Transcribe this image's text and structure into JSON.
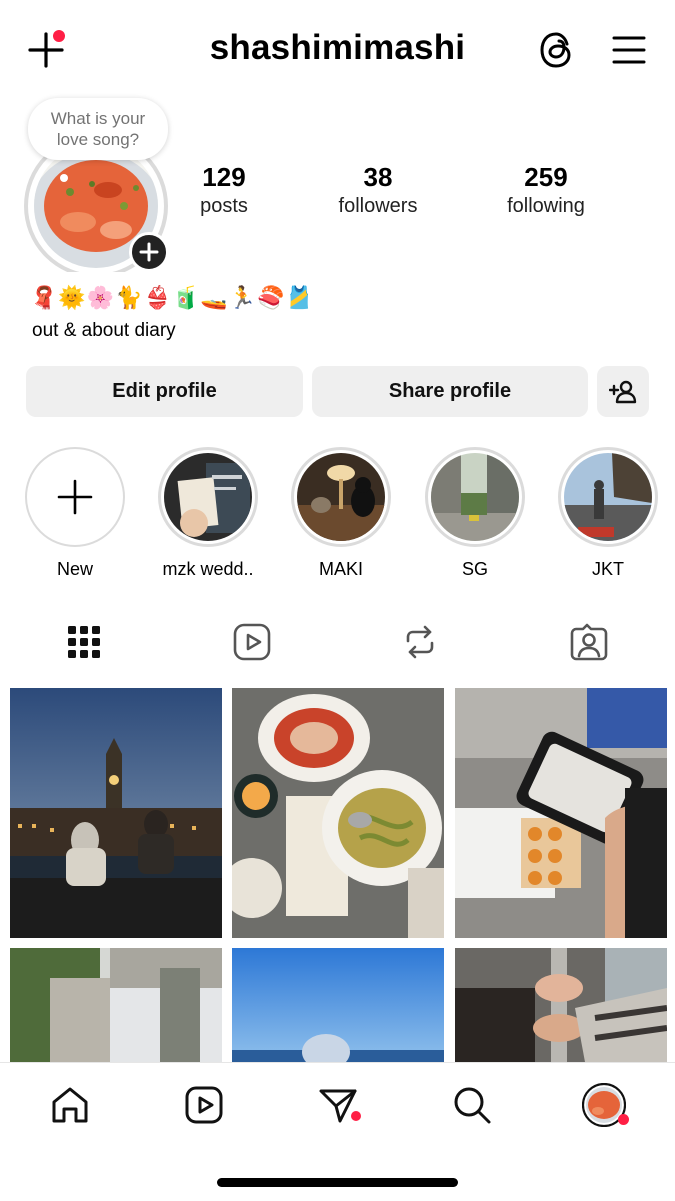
{
  "header": {
    "username": "shashimimashi"
  },
  "note": {
    "text": "What is your love song?"
  },
  "stats": [
    {
      "value": "129",
      "label": "posts"
    },
    {
      "value": "38",
      "label": "followers"
    },
    {
      "value": "259",
      "label": "following"
    }
  ],
  "bio": {
    "emojis": "🧣🌞🌸🐈👙🧃🚤🏃🍣🎽",
    "text": "out & about diary"
  },
  "buttons": {
    "edit": "Edit profile",
    "share": "Share profile"
  },
  "highlights": [
    {
      "label": "New"
    },
    {
      "label": "mzk wedd.."
    },
    {
      "label": "MAKI"
    },
    {
      "label": "SG"
    },
    {
      "label": "JKT"
    }
  ],
  "tabs": [
    "grid-icon",
    "reels-icon",
    "reposts-icon",
    "tagged-icon"
  ],
  "nav": [
    "home-icon",
    "reels-icon",
    "messages-icon",
    "search-icon",
    "profile-avatar"
  ],
  "colors": {
    "notification": "#ff1f45",
    "button_bg": "#efefef",
    "ring": "#dbdbdb"
  }
}
